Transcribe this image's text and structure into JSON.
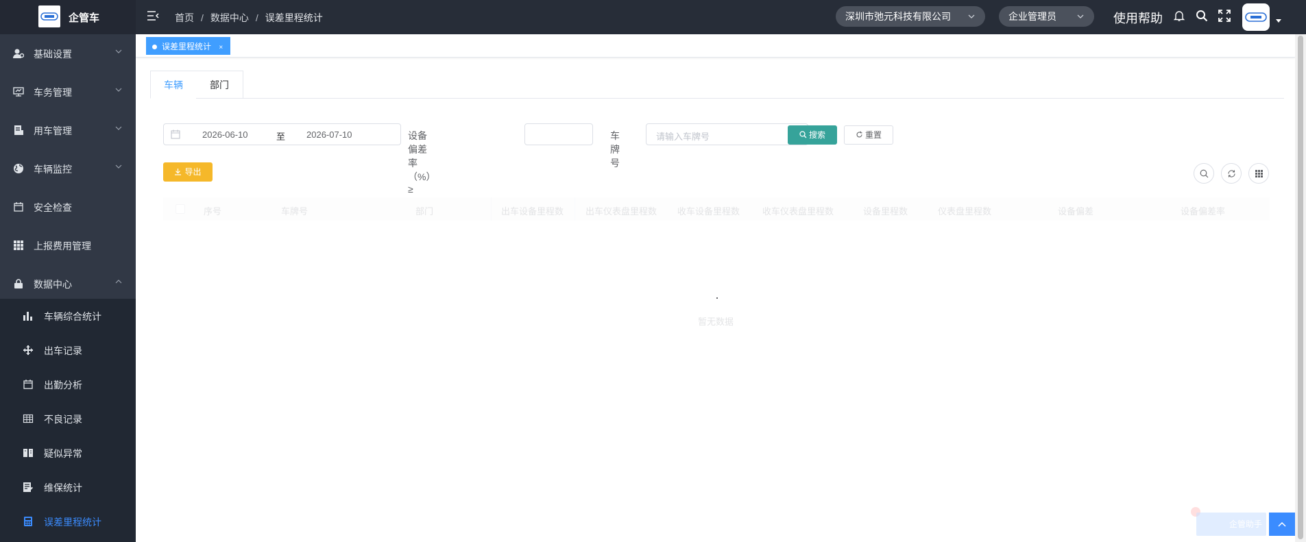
{
  "app": {
    "title": "企管车",
    "logo_text": "企管车"
  },
  "header": {
    "breadcrumb": [
      "首页",
      "数据中心",
      "误差里程统计"
    ],
    "breadcrumb_sep": "/",
    "company_select": "深圳市弛元科技有限公司",
    "role_select": "企业管理员",
    "help_label": "使用帮助",
    "icons": [
      "menu-fold-icon",
      "bell-icon",
      "search-icon",
      "fullscreen-icon",
      "avatar"
    ]
  },
  "sidebar": {
    "items": [
      {
        "label": "基础设置",
        "icon": "user-settings-icon",
        "expanded": false
      },
      {
        "label": "车务管理",
        "icon": "monitor-icon",
        "expanded": false
      },
      {
        "label": "用车管理",
        "icon": "document-icon",
        "expanded": false
      },
      {
        "label": "车辆监控",
        "icon": "globe-icon",
        "expanded": false
      },
      {
        "label": "安全检查",
        "icon": "calendar-icon"
      },
      {
        "label": "上报费用管理",
        "icon": "grid-icon"
      },
      {
        "label": "数据中心",
        "icon": "lock-icon",
        "expanded": true
      }
    ],
    "sub_items": [
      {
        "label": "车辆综合统计",
        "icon": "bar-chart-icon"
      },
      {
        "label": "出车记录",
        "icon": "move-icon"
      },
      {
        "label": "出勤分析",
        "icon": "calendar-icon"
      },
      {
        "label": "不良记录",
        "icon": "table-icon"
      },
      {
        "label": "疑似异常",
        "icon": "book-icon"
      },
      {
        "label": "维保统计",
        "icon": "edit-doc-icon"
      },
      {
        "label": "误差里程统计",
        "icon": "calculator-icon",
        "active": true
      }
    ]
  },
  "tags": [
    {
      "label": "误差里程统计",
      "close": "×"
    }
  ],
  "tabs": [
    {
      "label": "车辆",
      "active": true
    },
    {
      "label": "部门",
      "active": false
    }
  ],
  "filters": {
    "date_start": "2026-06-10",
    "date_separator": "至",
    "date_end": "2026-07-10",
    "deviation_label": "设备偏差率（%）≥",
    "deviation_value": "",
    "plate_label": "车牌号",
    "plate_placeholder": "请输入车牌号",
    "search_button": "搜索",
    "reset_button": "重置"
  },
  "toolbar": {
    "export_button": "导出"
  },
  "table": {
    "columns": [
      "序号",
      "车牌号",
      "部门",
      "出车设备里程数",
      "出车仪表盘里程数",
      "收车设备里程数",
      "收车仪表盘里程数",
      "设备里程数",
      "仪表盘里程数",
      "设备偏差",
      "设备偏差率"
    ],
    "rows": [],
    "empty_text": "暂无数据"
  },
  "float": {
    "label": "企管助手"
  },
  "colors": {
    "accent": "#409eff",
    "search": "#36a39a",
    "export": "#f5b82a",
    "header_bg": "#272d38",
    "sidebar_bg": "#313845"
  }
}
